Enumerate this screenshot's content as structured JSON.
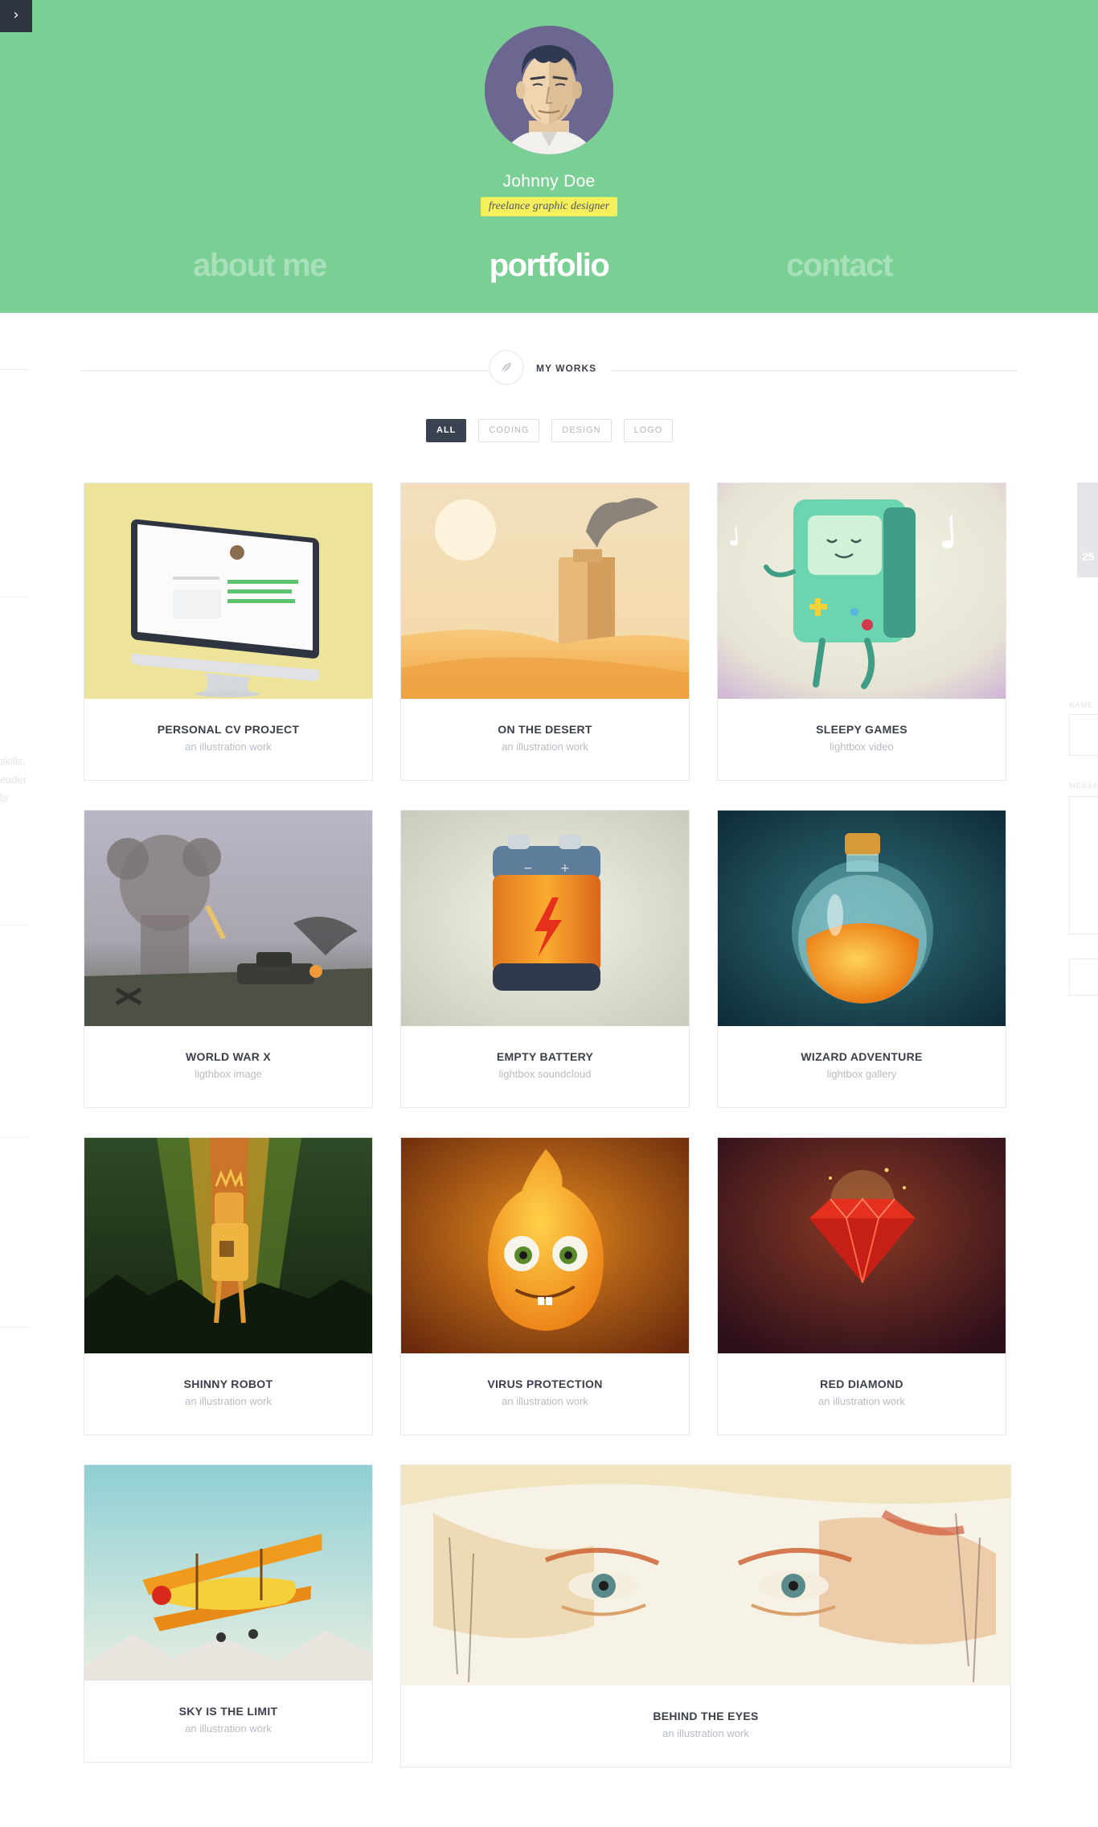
{
  "header": {
    "menu_toggle": "›",
    "name": "Johnny Doe",
    "tagline": "freelance graphic designer",
    "nav": [
      {
        "label": "about me",
        "active": false
      },
      {
        "label": "portfolio",
        "active": true
      },
      {
        "label": "contact",
        "active": false
      }
    ],
    "bg_color": "#7acf95"
  },
  "section": {
    "title": "MY WORKS",
    "icon": "leaf-icon"
  },
  "filters": [
    {
      "label": "ALL",
      "active": true
    },
    {
      "label": "CODING",
      "active": false
    },
    {
      "label": "DESIGN",
      "active": false
    },
    {
      "label": "LOGO",
      "active": false
    }
  ],
  "works": [
    {
      "title": "PERSONAL CV PROJECT",
      "subtitle": "an illustration work"
    },
    {
      "title": "ON THE DESERT",
      "subtitle": "an illustration work"
    },
    {
      "title": "SLEEPY GAMES",
      "subtitle": "lightbox video"
    },
    {
      "title": "WORLD WAR X",
      "subtitle": "ligthbox image"
    },
    {
      "title": "EMPTY BATTERY",
      "subtitle": "lightbox soundcloud"
    },
    {
      "title": "WIZARD ADVENTURE",
      "subtitle": "lightbox gallery"
    },
    {
      "title": "SHINNY ROBOT",
      "subtitle": "an illustration work"
    },
    {
      "title": "VIRUS PROTECTION",
      "subtitle": "an illustration work"
    },
    {
      "title": "RED DIAMOND",
      "subtitle": "an illustration work"
    },
    {
      "title": "SKY IS THE LIMIT",
      "subtitle": "an illustration work"
    },
    {
      "title": "BEHIND THE EYES",
      "subtitle": "an illustration work"
    }
  ],
  "ghost": {
    "left_text": [
      "skills,",
      "eader",
      "le"
    ],
    "right_labels": [
      "NAME",
      "MESSA"
    ],
    "right_number": "25"
  }
}
